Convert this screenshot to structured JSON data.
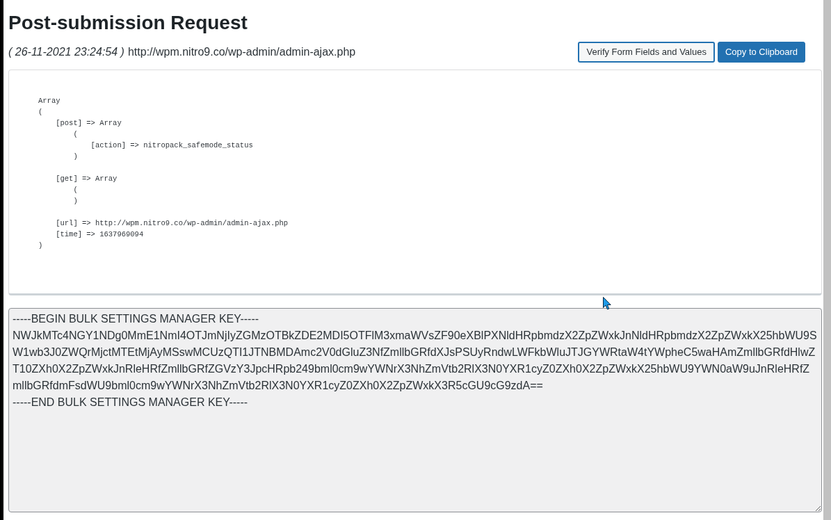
{
  "page": {
    "title": "Post-submission Request"
  },
  "request": {
    "timestamp": "( 26-11-2021 23:24:54 )",
    "url": "http://wpm.nitro9.co/wp-admin/admin-ajax.php"
  },
  "buttons": [
    {
      "label": "Verify Form Fields and Values",
      "kind": "secondary"
    },
    {
      "label": "Copy to Clipboard",
      "kind": "primary"
    }
  ],
  "request_dump": "Array\n(\n    [post] => Array\n        (\n            [action] => nitropack_safemode_status\n        )\n\n    [get] => Array\n        (\n        )\n\n    [url] => http://wpm.nitro9.co/wp-admin/admin-ajax.php\n    [time] => 1637969094\n)",
  "settings_key": {
    "lines": [
      "-----BEGIN BULK SETTINGS MANAGER KEY-----",
      "NWJkMTc4NGY1NDg0MmE1NmI4OTJmNjIyZGMzOTBkZDE2MDI5OTFlM3xmaWVsZF90eXBlPXNldHRpbmdzX2ZpZWxkJnNldHRpbmdzX2ZpZWxkX25hbWU9SW1wb3J0ZWQrMjctMTEtMjAyMSswMCUzQTI1JTNBMDAmc2V0dGluZ3NfZmllbGRfdXJsPSUyRndwLWFkbWluJTJGYWRtaW4tYWpheC5waHAmZmllbGRfdHlwZT10ZXh0X2ZpZWxkJnRleHRfZmllbGRfZGVzY3JpcHRpb249bml0cm9wYWNrX3NhZmVtb2RlX3N0YXR1cyZ0ZXh0X2ZpZWxkX25hbWU9YWN0aW9uJnRleHRfZmllbGRfdmFsdWU9bml0cm9wYWNrX3NhZmVtb2RlX3N0YXR1cyZ0ZXh0X2ZpZWxkX3R5cGU9cG9zdA==",
      "-----END BULK SETTINGS MANAGER KEY-----"
    ]
  }
}
